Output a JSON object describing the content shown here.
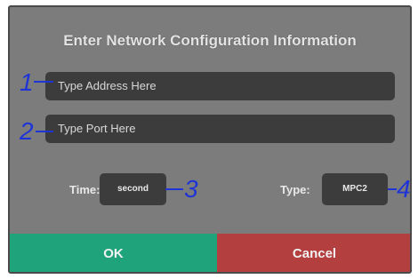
{
  "dialog": {
    "title": "Enter Network Configuration Information",
    "address_placeholder": "Type Address Here",
    "port_placeholder": "Type Port Here",
    "time_label": "Time:",
    "time_value": "second",
    "type_label": "Type:",
    "type_value": "MPC2",
    "ok_label": "OK",
    "cancel_label": "Cancel"
  },
  "annotations": {
    "n1": "1",
    "n2": "2",
    "n3": "3",
    "n4": "4"
  },
  "colors": {
    "dialog_bg": "#7c7c7c",
    "field_bg": "#3c3c3c",
    "ok_bg": "#1fa37a",
    "cancel_bg": "#b33f3f",
    "annotation": "#1f34d6"
  }
}
